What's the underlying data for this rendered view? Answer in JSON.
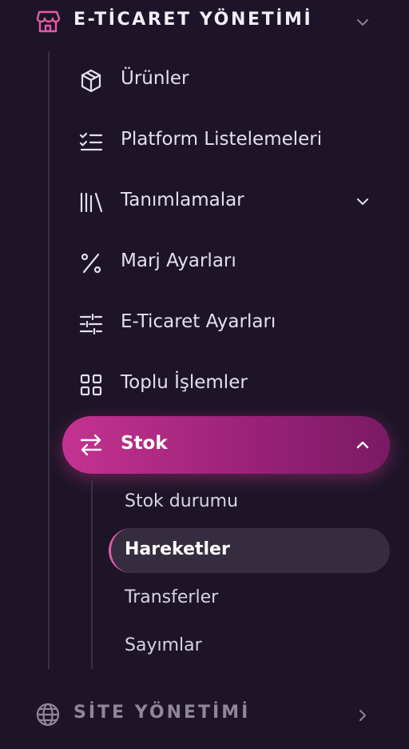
{
  "ecommerce": {
    "title": "E-TİCARET YÖNETİMİ",
    "items": [
      {
        "label": "Ürünler",
        "icon": "package-icon"
      },
      {
        "label": "Platform Listelemeleri",
        "icon": "checklist-icon"
      },
      {
        "label": "Tanımlamalar",
        "icon": "library-icon"
      },
      {
        "label": "Marj Ayarları",
        "icon": "percent-icon"
      },
      {
        "label": "E-Ticaret Ayarları",
        "icon": "sliders-icon"
      },
      {
        "label": "Toplu İşlemler",
        "icon": "grid-icon"
      },
      {
        "label": "Stok",
        "icon": "arrows-swap-icon"
      }
    ],
    "stock_sub": [
      {
        "label": "Stok durumu"
      },
      {
        "label": "Hareketler"
      },
      {
        "label": "Transferler"
      },
      {
        "label": "Sayımlar"
      }
    ]
  },
  "site": {
    "title": "SİTE YÖNETİMİ",
    "icon": "globe-icon"
  },
  "colors": {
    "accent": "#c4338f",
    "accent_dark": "#7a1a63",
    "background": "#1d1527",
    "active_sub_bg": "#352c40",
    "store_icon": "#e35aa9"
  }
}
